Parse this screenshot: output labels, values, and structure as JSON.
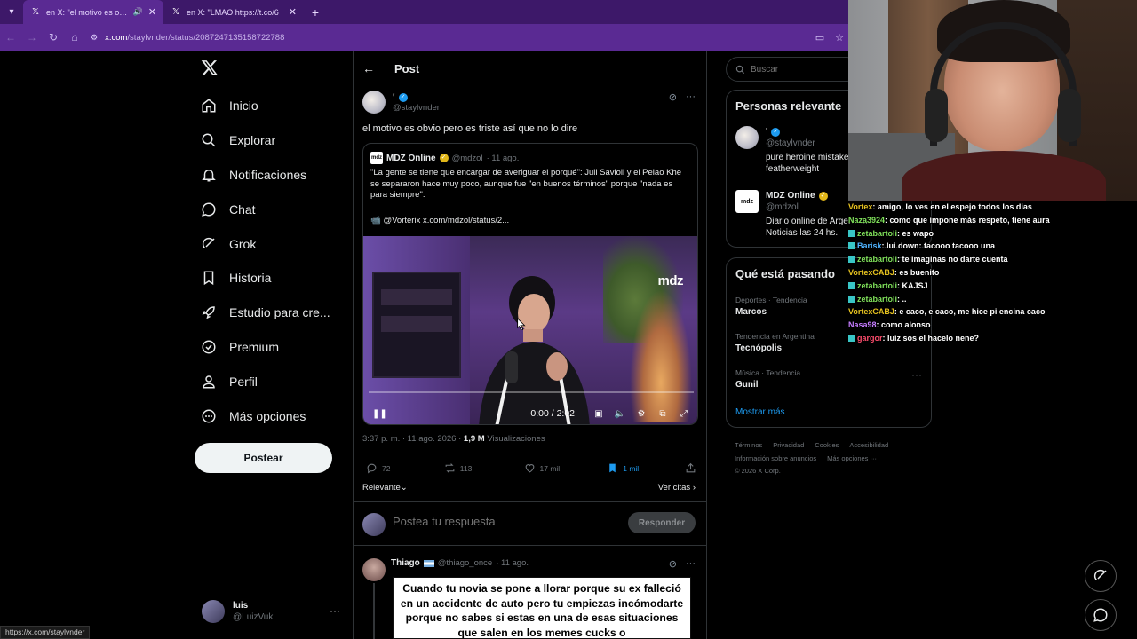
{
  "browser": {
    "tabs": [
      {
        "title": "en X: \"el motivo es obvio pero es triste así que no lo dire\"",
        "active": true
      },
      {
        "title": "en X: \"LMAO https://t.co/6",
        "active": false
      }
    ],
    "url_host": "x.com",
    "url_path": "/staylvnder/status/2087247135158722788",
    "status_url": "https://x.com/staylvnder"
  },
  "nav": {
    "items": [
      {
        "label": "Inicio",
        "icon": "home-icon"
      },
      {
        "label": "Explorar",
        "icon": "search-icon"
      },
      {
        "label": "Notificaciones",
        "icon": "bell-icon"
      },
      {
        "label": "Chat",
        "icon": "chat-icon"
      },
      {
        "label": "Grok",
        "icon": "grok-icon"
      },
      {
        "label": "Historia",
        "icon": "bookmark-icon"
      },
      {
        "label": "Estudio para cre...",
        "icon": "rocket-icon"
      },
      {
        "label": "Premium",
        "icon": "verified-icon"
      },
      {
        "label": "Perfil",
        "icon": "person-icon"
      },
      {
        "label": "Más opciones",
        "icon": "more-circle-icon"
      }
    ],
    "post_button": "Postear",
    "account": {
      "name": "luis",
      "handle": "@LuizVuk"
    }
  },
  "post": {
    "header_title": "Post",
    "author_name": "'",
    "author_handle": "@staylvnder",
    "text": "el motivo es obvio pero es triste así que no lo dire",
    "quote": {
      "logo": "mdz",
      "name": "MDZ Online",
      "handle": "@mdzol",
      "date": "· 11 ago.",
      "text": "\"La gente se tiene que encargar de averiguar el porqué\": Juli Savioli y el Pelao Khe se separaron hace muy poco, aunque fue \"en buenos términos\" porque \"nada es para siempre\".",
      "link": "📹 @Vorterix  x.com/mdzol/status/2...",
      "video_mark": "mdz",
      "video_time": "0:00 / 2:02"
    },
    "timestamp": "3:37 p. m. · 11 ago. 2026 ·",
    "views_count": "1,9 M",
    "views_label": "Visualizaciones",
    "actions": {
      "replies": "72",
      "reposts": "113",
      "likes": "17 mil",
      "bookmarks": "1 mil"
    },
    "sort_label": "Relevante",
    "view_quotes": "Ver citas",
    "reply_placeholder": "Postea tu respuesta",
    "reply_button": "Responder",
    "reply": {
      "name": "Thiago",
      "handle": "@thiago_once",
      "date": "· 11 ago.",
      "meme_text": "Cuando tu novia se pone a llorar porque su ex falleció en un accidente de auto pero tu empiezas incómodarte porque no sabes si estas en una de esas situaciones que salen en los memes cucks o"
    }
  },
  "sidebar": {
    "search_placeholder": "Buscar",
    "relevant_title": "Personas relevante",
    "people": [
      {
        "name": "'",
        "handle": "@staylvnder",
        "bio": "pure heroine mistake featherweight"
      },
      {
        "name": "MDZ Online",
        "handle": "@mdzol",
        "bio": "Diario online de Argentina. Noticias las 24 hs."
      }
    ],
    "trends_title": "Qué está pasando",
    "trends": [
      {
        "context": "Deportes · Tendencia",
        "name": "Marcos"
      },
      {
        "context": "Tendencia en Argentina",
        "name": "Tecnópolis"
      },
      {
        "context": "Música · Tendencia",
        "name": "Gunil"
      }
    ],
    "show_more": "Mostrar más",
    "footer": [
      "Términos",
      "Privacidad",
      "Cookies",
      "Accesibilidad",
      "Información sobre anuncios",
      "Más opciones ···",
      "© 2026 X Corp."
    ]
  },
  "chat": {
    "messages": [
      {
        "user": "Vortex",
        "user_color": "#e6c21f",
        "badge": false,
        "text": "amigo, lo ves en el espejo todos los dias"
      },
      {
        "user": "Naza3924",
        "user_color": "#7fe05a",
        "badge": false,
        "text": "como que impone más respeto, tiene aura"
      },
      {
        "user": "zetabartoli",
        "user_color": "#7fe05a",
        "badge": true,
        "text": "es wapo"
      },
      {
        "user": "Barisk",
        "user_color": "#4fb3ff",
        "badge": true,
        "text": "lui down: tacooo tacooo una"
      },
      {
        "user": "zetabartoli",
        "user_color": "#7fe05a",
        "badge": true,
        "text": "te imaginas no darte cuenta"
      },
      {
        "user": "VortexCABJ",
        "user_color": "#e6c21f",
        "badge": false,
        "text": "es buenito"
      },
      {
        "user": "zetabartoli",
        "user_color": "#7fe05a",
        "badge": true,
        "text": "KAJSJ"
      },
      {
        "user": "zetabartoli",
        "user_color": "#7fe05a",
        "badge": true,
        "text": ".."
      },
      {
        "user": "VortexCABJ",
        "user_color": "#e6c21f",
        "badge": false,
        "text": "e caco, e caco, me hice pi encina caco"
      },
      {
        "user": "Nasa98",
        "user_color": "#c57cff",
        "badge": false,
        "text": "como alonso"
      },
      {
        "user": "gargor",
        "user_color": "#ff4d6d",
        "badge": true,
        "text": "luiz sos el hacelo nene?"
      }
    ]
  },
  "colors": {
    "accent": "#1d9bf0",
    "tabbar": "#3d1869",
    "addressbar": "#5a2a93"
  }
}
